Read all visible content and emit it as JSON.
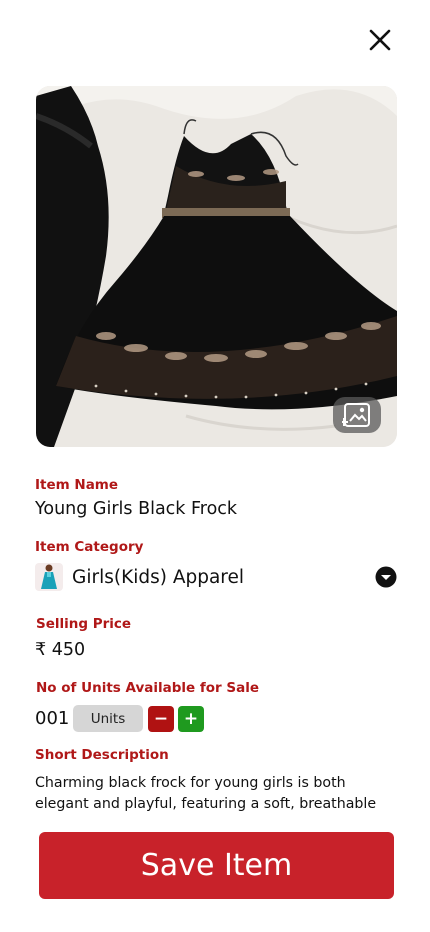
{
  "header": {
    "close_icon": "close-icon"
  },
  "item_image": {
    "alt": "black frock photo",
    "gallery_icon": "image-gallery-icon"
  },
  "fields": {
    "item_name": {
      "label": "Item Name",
      "value": "Young Girls Black Frock"
    },
    "item_category": {
      "label": "Item Category",
      "value": "Girls(Kids) Apparel",
      "dropdown_icon": "chevron-down-circle-icon"
    },
    "selling_price": {
      "label": "Selling Price",
      "value": "₹ 450"
    },
    "units": {
      "label": "No of  Units Available for Sale",
      "quantity": "001",
      "unit_label": "Units",
      "decrement": "−",
      "increment": "+"
    },
    "short_description": {
      "label": "Short Description",
      "text": "Charming black frock for young girls is both elegant and playful, featuring a soft, breathable"
    }
  },
  "actions": {
    "save_label": "Save Item"
  },
  "colors": {
    "label_red": "#b01818",
    "save_red": "#c8222a",
    "minus_red": "#b01212",
    "plus_green": "#1f9a1f"
  }
}
